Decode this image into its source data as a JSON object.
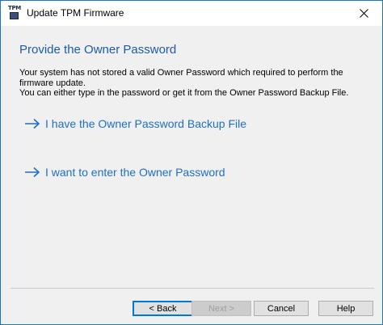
{
  "window": {
    "title": "Update TPM Firmware",
    "icon": "tpm-chip-icon",
    "icon_label": "TPM",
    "close_icon": "close-icon"
  },
  "main": {
    "heading": "Provide the Owner Password",
    "description_line1": "Your system has not stored a valid Owner Password which required to perform the firmware update.",
    "description_line2": "You can either type in the password or get it from the Owner Password Backup File.",
    "options": [
      {
        "label": "I have the Owner Password Backup File",
        "icon": "arrow-right-icon"
      },
      {
        "label": "I want to enter the Owner Password",
        "icon": "arrow-right-icon"
      }
    ]
  },
  "footer": {
    "back_label": "< Back",
    "next_label": "Next >",
    "cancel_label": "Cancel",
    "help_label": "Help"
  },
  "colors": {
    "heading": "#1e5aa8",
    "link": "#1e6fc4",
    "window_border": "#1a73c8",
    "background": "#f0f0f0"
  }
}
